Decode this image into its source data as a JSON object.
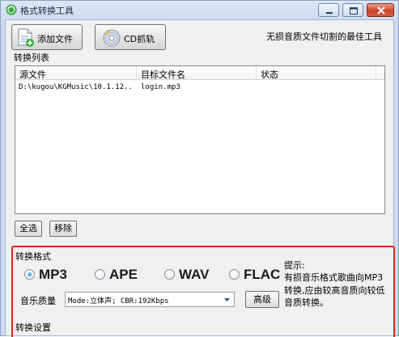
{
  "window": {
    "title": "格式转换工具",
    "controls": {
      "minimize": "minimize",
      "maximize": "maximize",
      "close": "close"
    }
  },
  "toolbar": {
    "add_file_label": "添加文件",
    "cd_rip_label": "CD抓轨",
    "slogan": "无损音质文件切割的最佳工具"
  },
  "convert_list": {
    "label": "转换列表",
    "columns": [
      "源文件",
      "目标文件名",
      "状态"
    ],
    "rows": [
      {
        "source": "D:\\kugou\\KGMusic\\10.1.12..",
        "target": "login.mp3",
        "status": ""
      }
    ],
    "select_all_label": "全选",
    "remove_label": "移除"
  },
  "format": {
    "label": "转换格式",
    "options": [
      {
        "label": "MP3",
        "selected": true
      },
      {
        "label": "APE",
        "selected": false
      },
      {
        "label": "WAV",
        "selected": false
      },
      {
        "label": "FLAC",
        "selected": false
      }
    ],
    "quality_label": "音乐质量",
    "quality_value": "Mode:立体声; CBR:192Kbps",
    "advanced_label": "高级",
    "hint_title": "提示:",
    "hint_body": "有损音乐格式歌曲向MP3转换,应由较高音质向较低音质转换。"
  },
  "settings": {
    "label": "转换设置"
  },
  "colors": {
    "highlight_frame": "#e3201b",
    "radio_selected": "#1a6fcf"
  },
  "icons": {
    "app": "app-logo-icon",
    "add_file": "add-file-icon",
    "cd": "cd-disc-icon",
    "dropdown": "chevron-down-icon"
  }
}
